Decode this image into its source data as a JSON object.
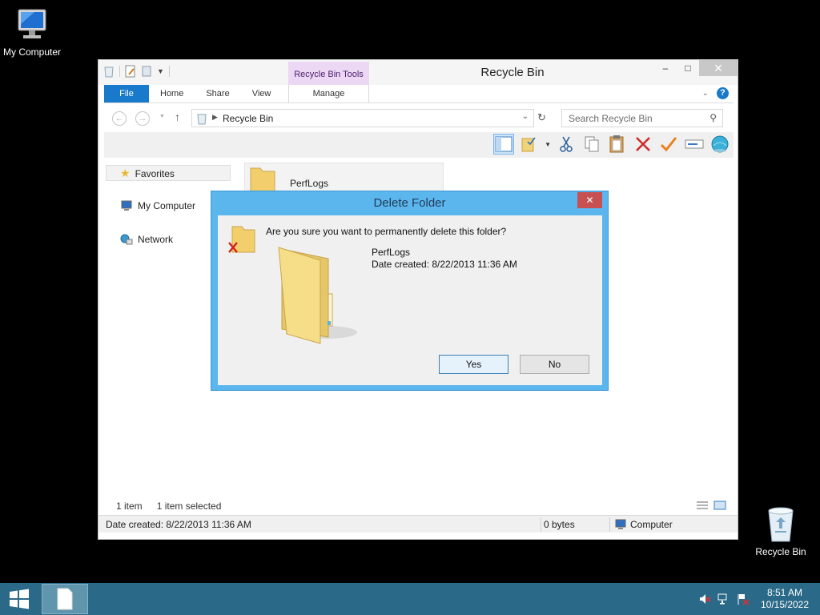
{
  "desktop": {
    "icons": [
      {
        "label": "My Computer"
      },
      {
        "label": "Recycle Bin"
      }
    ]
  },
  "window": {
    "title": "Recycle Bin",
    "contextual_tab": "Recycle Bin Tools",
    "caption": {
      "minimize": "–",
      "maximize": "□",
      "close": "✕"
    },
    "tabs": {
      "file": "File",
      "home": "Home",
      "share": "Share",
      "view": "View",
      "manage": "Manage"
    },
    "help_label": "?",
    "address": {
      "path": "Recycle Bin"
    },
    "search": {
      "placeholder": "Search Recycle Bin"
    },
    "nav": {
      "favorites": "Favorites",
      "my_computer": "My Computer",
      "network": "Network"
    },
    "file_item": {
      "name": "PerfLogs"
    },
    "status": {
      "item_count": "1 item",
      "selected": "1 item selected",
      "date_created": "Date created: 8/22/2013 11:36 AM",
      "size": "0 bytes",
      "location": "Computer"
    }
  },
  "dialog": {
    "title": "Delete Folder",
    "close": "✕",
    "question": "Are you sure you want to permanently delete this folder?",
    "folder_name": "PerfLogs",
    "date_created": "Date created: 8/22/2013 11:36 AM",
    "yes_label": "Yes",
    "no_label": "No"
  },
  "taskbar": {
    "time": "8:51 AM",
    "date": "10/15/2022"
  },
  "colors": {
    "accent": "#1979ca",
    "dialog_frame": "#5cb6ee",
    "taskbar": "#2a6a88",
    "contextual": "#ecd7f4"
  }
}
